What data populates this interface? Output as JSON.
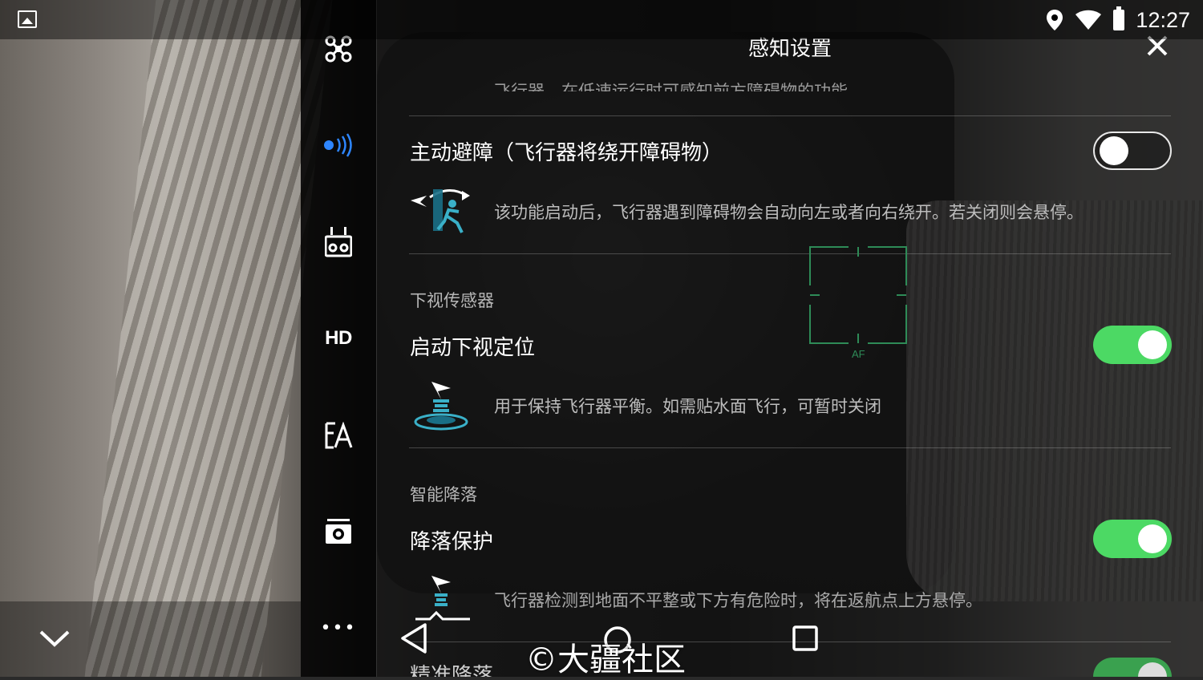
{
  "status_bar": {
    "time": "12:27",
    "left_icon": "gallery-icon",
    "right_icons": [
      "location-pin-icon",
      "wifi-icon",
      "battery-icon"
    ]
  },
  "sidebar": {
    "items": [
      {
        "name": "aircraft-icon",
        "label": ""
      },
      {
        "name": "sensing-radar-icon",
        "label": "",
        "active": true,
        "color": "#2e86ff"
      },
      {
        "name": "remote-controller-icon",
        "label": ""
      },
      {
        "name": "hd-transmission",
        "label": "HD"
      },
      {
        "name": "gimbal-icon",
        "label": ""
      },
      {
        "name": "camera-icon",
        "label": ""
      },
      {
        "name": "more-icon",
        "label": "•••"
      }
    ]
  },
  "panel": {
    "title": "感知设置",
    "clipped_top_text": "飞行器，在低速运行时可感知前方障碍物的功能。",
    "obstacle": {
      "title": "主动避障（飞行器将绕开障碍物）",
      "description": "该功能启动后，飞行器遇到障碍物会自动向左或者向右绕开。若关闭则会悬停。",
      "toggle_on": false
    },
    "downward_section": {
      "header": "下视传感器",
      "title": "启动下视定位",
      "description": "用于保持飞行器平衡。如需贴水面飞行，可暂时关闭",
      "toggle_on": true
    },
    "landing_section": {
      "header": "智能降落",
      "title": "降落保护",
      "description": "飞行器检测到地面不平整或下方有危险时，将在返航点上方悬停。",
      "toggle_on": true
    },
    "precise_landing": {
      "title": "精准降落",
      "toggle_on": true
    }
  },
  "af_label": "AF",
  "nav": {
    "back": "nav-back-icon",
    "home": "nav-home-icon",
    "recents": "nav-recents-icon"
  },
  "watermark": "©大疆社区",
  "colors": {
    "toggle_on": "#4cd964",
    "accent_blue": "#2e86ff",
    "af_frame": "#2e8b57"
  }
}
